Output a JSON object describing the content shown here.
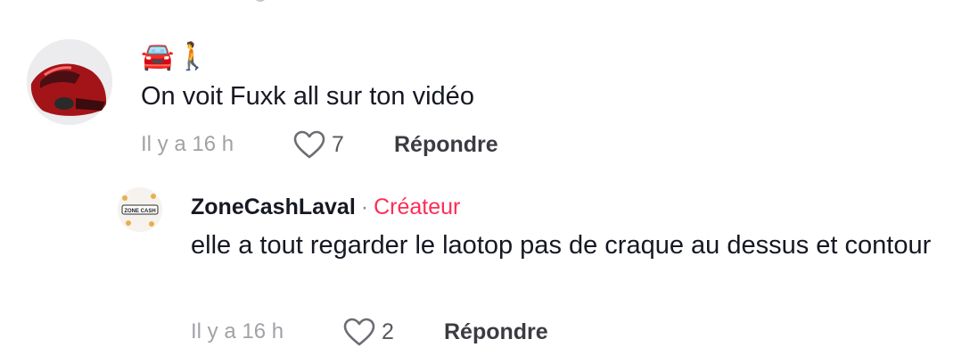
{
  "comment": {
    "author_emoji": "🚘🚶",
    "text": "On voit Fuxk all sur ton vidéo",
    "time": "Il y a 16 h",
    "likes": "7",
    "reply_label": "Répondre"
  },
  "reply": {
    "author": "ZoneCashLaval",
    "separator": "·",
    "badge": "Créateur",
    "text": "elle a tout regarder le laotop pas de craque au dessus et contour",
    "time": "Il y a 16 h",
    "likes": "2",
    "reply_label": "Répondre",
    "avatar_logo_text": "ZONE CASH"
  },
  "colors": {
    "creator_badge": "#fe2c55",
    "meta_text": "#a1a2a7",
    "primary_text": "#161823"
  },
  "icons": {
    "like": "heart-outline-icon"
  }
}
